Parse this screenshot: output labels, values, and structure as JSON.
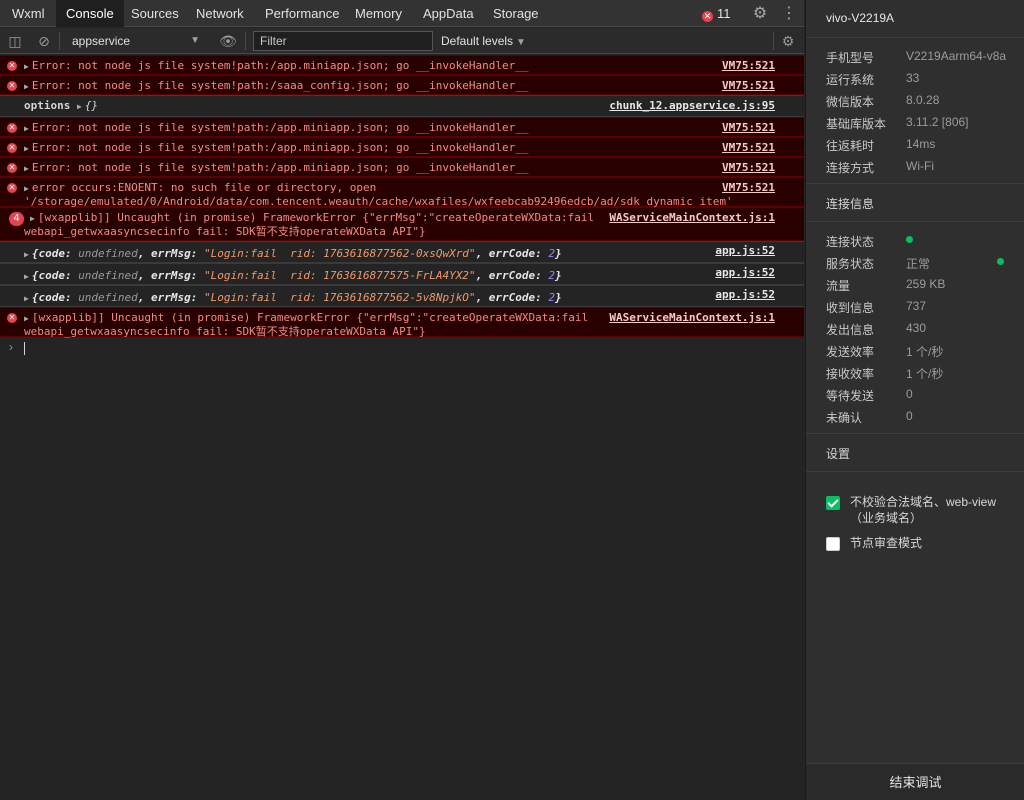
{
  "tabs": [
    "Wxml",
    "Console",
    "Sources",
    "Network",
    "Performance",
    "Memory",
    "AppData",
    "Storage"
  ],
  "active_tab": "Console",
  "error_count": "11",
  "toolbar": {
    "context": "appservice",
    "filter_placeholder": "Filter",
    "levels": "Default levels"
  },
  "messages": [
    {
      "type": "error",
      "text": "Error: not node js file system!path:/app.miniapp.json; go __invokeHandler__",
      "source": "VM75:521"
    },
    {
      "type": "error",
      "text": "Error: not node js file system!path:/saaa_config.json; go __invokeHandler__",
      "source": "VM75:521"
    },
    {
      "type": "log",
      "prefix": "options",
      "text": "{}",
      "source": "chunk_12.appservice.js:95"
    },
    {
      "type": "error",
      "text": "Error: not node js file system!path:/app.miniapp.json; go __invokeHandler__",
      "source": "VM75:521"
    },
    {
      "type": "error",
      "text": "Error: not node js file system!path:/app.miniapp.json; go __invokeHandler__",
      "source": "VM75:521"
    },
    {
      "type": "error",
      "text": "Error: not node js file system!path:/app.miniapp.json; go __invokeHandler__",
      "source": "VM75:521"
    },
    {
      "type": "error",
      "text": "error occurs:ENOENT: no such file or directory, open",
      "text2": "'/storage/emulated/0/Android/data/com.tencent.weauth/cache/wxafiles/wxfeebcab92496edcb/ad/sdk_dynamic_item'",
      "source": "VM75:521"
    },
    {
      "type": "error",
      "count": "4",
      "text": "[wxapplib]] Uncaught (in promise) FrameworkError {\"errMsg\":\"createOperateWXData:fail",
      "text2": "webapi_getwxaasyncsecinfo fail: SDK暂不支持operateWXData API\"}",
      "source": "WAServiceMainContext.js:1"
    },
    {
      "type": "log",
      "obj": {
        "code": "undefined",
        "errMsg": "\"Login:fail  rid: 1763616877562-0xsQwXrd\"",
        "errCode": "2"
      },
      "source": "app.js:52"
    },
    {
      "type": "log",
      "obj": {
        "code": "undefined",
        "errMsg": "\"Login:fail  rid: 1763616877575-FrLA4YX2\"",
        "errCode": "2"
      },
      "source": "app.js:52"
    },
    {
      "type": "log",
      "obj": {
        "code": "undefined",
        "errMsg": "\"Login:fail  rid: 1763616877562-5v8NpjkO\"",
        "errCode": "2"
      },
      "source": "app.js:52"
    },
    {
      "type": "error",
      "text": "[wxapplib]] Uncaught (in promise) FrameworkError {\"errMsg\":\"createOperateWXData:fail",
      "text2": "webapi_getwxaasyncsecinfo fail: SDK暂不支持operateWXData API\"}",
      "source": "WAServiceMainContext.js:1"
    }
  ],
  "device": {
    "name": "vivo-V2219A",
    "info": [
      {
        "label": "手机型号",
        "value": "V2219Aarm64-v8a"
      },
      {
        "label": "运行系统",
        "value": "33"
      },
      {
        "label": "微信版本",
        "value": "8.0.28"
      },
      {
        "label": "基础库版本",
        "value": "3.11.2 [806]"
      },
      {
        "label": "往返耗时",
        "value": "14ms"
      },
      {
        "label": "连接方式",
        "value": "Wi-Fi"
      }
    ]
  },
  "connection": {
    "title": "连接信息",
    "rows": [
      {
        "label": "连接状态",
        "value": ""
      },
      {
        "label": "服务状态",
        "value": "正常"
      },
      {
        "label": "流量",
        "value": "259 KB"
      },
      {
        "label": "收到信息",
        "value": "737"
      },
      {
        "label": "发出信息",
        "value": "430"
      },
      {
        "label": "发送效率",
        "value": "1 个/秒"
      },
      {
        "label": "接收效率",
        "value": "1 个/秒"
      },
      {
        "label": "等待发送",
        "value": "0"
      },
      {
        "label": "未确认",
        "value": "0"
      }
    ]
  },
  "settings": {
    "title": "设置",
    "options": [
      {
        "label": "不校验合法域名、web-view（业务域名）",
        "checked": true
      },
      {
        "label": "节点审查模式",
        "checked": false
      }
    ]
  },
  "end_button": "结束调试"
}
